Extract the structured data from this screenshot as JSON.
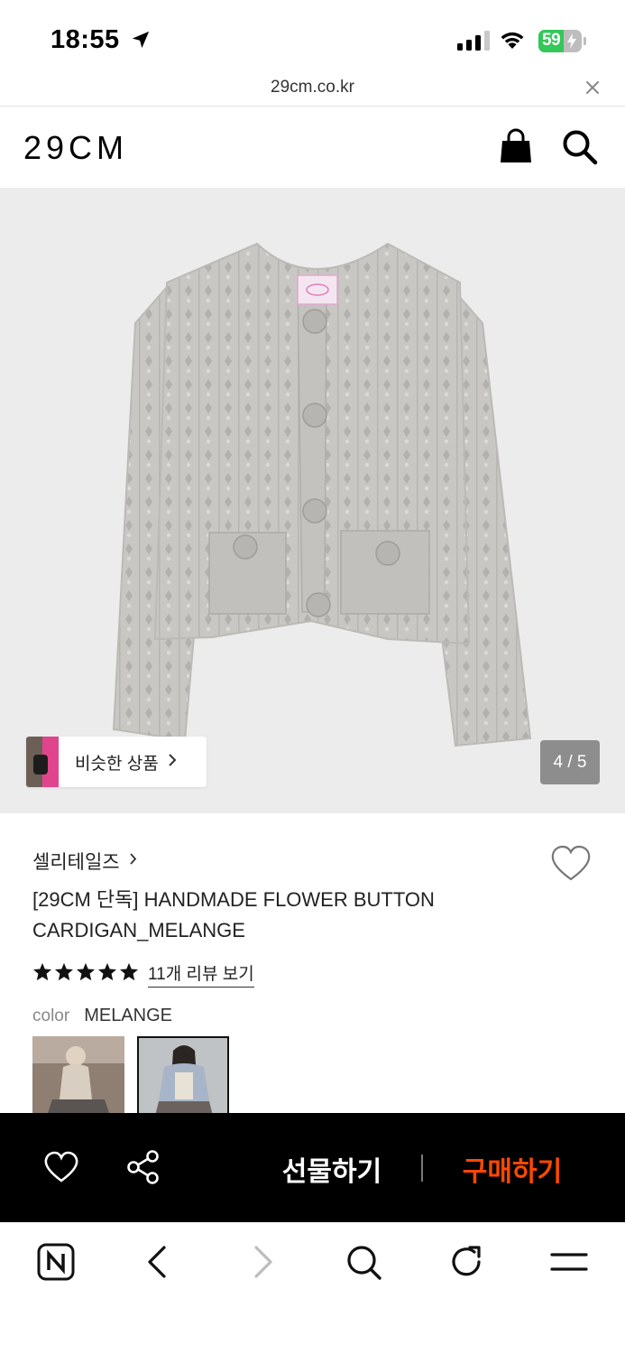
{
  "status_bar": {
    "time": "18:55",
    "battery": "59",
    "battery_level": 0.59,
    "signal_bars_active": 3,
    "icons": [
      "location-arrow-icon",
      "cellular-signal-icon",
      "wifi-icon",
      "battery-charging-icon"
    ]
  },
  "browser": {
    "url": "29cm.co.kr",
    "toolbar_icons": [
      "naver-n-icon",
      "back-icon",
      "forward-icon",
      "search-icon",
      "reload-icon",
      "menu-icon"
    ]
  },
  "header": {
    "logo": "29CM",
    "icons": [
      "shopping-bag-icon",
      "search-icon"
    ]
  },
  "gallery": {
    "similar_label": "비슷한 상품",
    "page_indicator": "4 / 5"
  },
  "product": {
    "brand": "셀리테일즈",
    "title": "[29CM 단독] HANDMADE FLOWER BUTTON CARDIGAN_MELANGE",
    "rating_stars": 5,
    "review_link": "11개 리뷰 보기",
    "option_label": "color",
    "option_value": "MELANGE",
    "swatch_count": 2,
    "selected_swatch": 2
  },
  "actions": {
    "gift": "선물하기",
    "buy": "구매하기",
    "buy_color": "#ff4800",
    "icons": [
      "heart-icon",
      "share-icon"
    ]
  }
}
